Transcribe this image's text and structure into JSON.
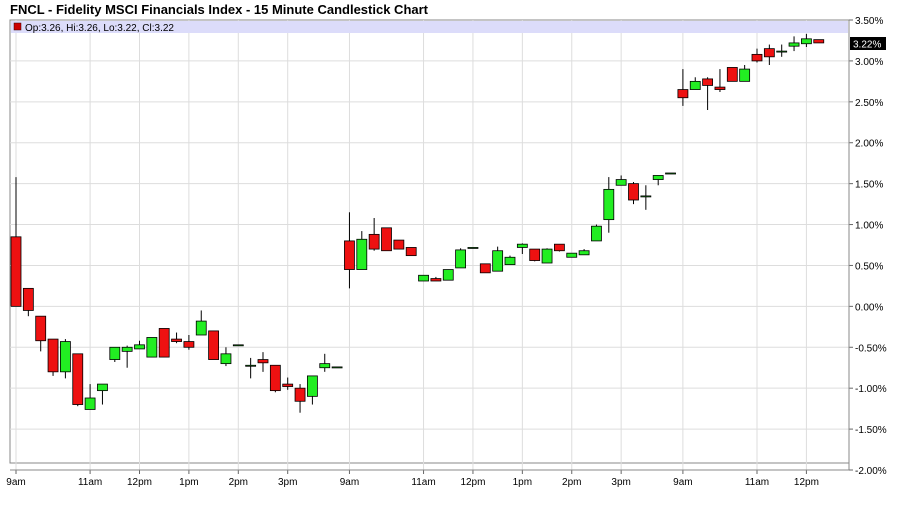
{
  "title": "FNCL - Fidelity MSCI Financials Index - 15 Minute Candlestick Chart",
  "ohlc_label": "Op:3.26, Hi:3.26, Lo:3.22, Cl:3.22",
  "last_value_label": "3.22%",
  "colors": {
    "up": "#22ee22",
    "down": "#ee1111",
    "grid": "#dddddd",
    "highlight": "#dcdcfa",
    "marker": "#cc0000"
  },
  "chart_data": {
    "type": "candlestick",
    "ylim": [
      -2.0,
      3.5
    ],
    "yticks": [
      {
        "v": 3.5,
        "label": "3.50%"
      },
      {
        "v": 3.0,
        "label": "3.00%"
      },
      {
        "v": 2.5,
        "label": "2.50%"
      },
      {
        "v": 2.0,
        "label": "2.00%"
      },
      {
        "v": 1.5,
        "label": "1.50%"
      },
      {
        "v": 1.0,
        "label": "1.00%"
      },
      {
        "v": 0.5,
        "label": "0.50%"
      },
      {
        "v": 0.0,
        "label": "0.00%"
      },
      {
        "v": -0.5,
        "label": "-0.50%"
      },
      {
        "v": -1.0,
        "label": "-1.00%"
      },
      {
        "v": -1.5,
        "label": "-1.50%"
      },
      {
        "v": -2.0,
        "label": "-2.00%"
      }
    ],
    "xticks": [
      {
        "i": 0,
        "label": "9am"
      },
      {
        "i": 6,
        "label": "11am"
      },
      {
        "i": 10,
        "label": "12pm"
      },
      {
        "i": 14,
        "label": "1pm"
      },
      {
        "i": 18,
        "label": "2pm"
      },
      {
        "i": 22,
        "label": "3pm"
      },
      {
        "i": 27,
        "label": "9am"
      },
      {
        "i": 33,
        "label": "11am"
      },
      {
        "i": 37,
        "label": "12pm"
      },
      {
        "i": 41,
        "label": "1pm"
      },
      {
        "i": 45,
        "label": "2pm"
      },
      {
        "i": 49,
        "label": "3pm"
      },
      {
        "i": 54,
        "label": "9am"
      },
      {
        "i": 60,
        "label": "11am"
      },
      {
        "i": 64,
        "label": "12pm"
      }
    ],
    "candles": [
      {
        "o": 0.85,
        "h": 1.58,
        "l": 0.0,
        "c": 0.0
      },
      {
        "o": 0.22,
        "h": 0.22,
        "l": -0.12,
        "c": -0.05
      },
      {
        "o": -0.12,
        "h": -0.12,
        "l": -0.55,
        "c": -0.42
      },
      {
        "o": -0.4,
        "h": -0.45,
        "l": -0.85,
        "c": -0.8
      },
      {
        "o": -0.8,
        "h": -0.4,
        "l": -0.88,
        "c": -0.43
      },
      {
        "o": -0.58,
        "h": -0.58,
        "l": -1.22,
        "c": -1.2
      },
      {
        "o": -1.26,
        "h": -0.95,
        "l": -1.26,
        "c": -1.12
      },
      {
        "o": -1.03,
        "h": -0.95,
        "l": -1.2,
        "c": -0.95
      },
      {
        "o": -0.65,
        "h": -0.5,
        "l": -0.68,
        "c": -0.5
      },
      {
        "o": -0.55,
        "h": -0.48,
        "l": -0.75,
        "c": -0.5
      },
      {
        "o": -0.52,
        "h": -0.42,
        "l": -0.52,
        "c": -0.47
      },
      {
        "o": -0.62,
        "h": -0.38,
        "l": -0.62,
        "c": -0.38
      },
      {
        "o": -0.27,
        "h": -0.27,
        "l": -0.62,
        "c": -0.62
      },
      {
        "o": -0.4,
        "h": -0.32,
        "l": -0.45,
        "c": -0.43
      },
      {
        "o": -0.43,
        "h": -0.35,
        "l": -0.53,
        "c": -0.5
      },
      {
        "o": -0.35,
        "h": -0.05,
        "l": -0.35,
        "c": -0.18
      },
      {
        "o": -0.3,
        "h": -0.3,
        "l": -0.65,
        "c": -0.65
      },
      {
        "o": -0.7,
        "h": -0.5,
        "l": -0.73,
        "c": -0.58
      },
      {
        "o": -0.47,
        "h": -0.47,
        "l": -0.47,
        "c": -0.47
      },
      {
        "o": -0.72,
        "h": -0.63,
        "l": -0.88,
        "c": -0.72
      },
      {
        "o": -0.65,
        "h": -0.56,
        "l": -0.8,
        "c": -0.69
      },
      {
        "o": -0.72,
        "h": -0.72,
        "l": -1.05,
        "c": -1.03
      },
      {
        "o": -0.95,
        "h": -0.87,
        "l": -1.02,
        "c": -0.98
      },
      {
        "o": -1.0,
        "h": -0.95,
        "l": -1.3,
        "c": -1.16
      },
      {
        "o": -1.1,
        "h": -0.86,
        "l": -1.2,
        "c": -0.85
      },
      {
        "o": -0.75,
        "h": -0.58,
        "l": -0.8,
        "c": -0.7
      },
      {
        "o": -0.74,
        "h": -0.74,
        "l": -0.74,
        "c": -0.74
      },
      {
        "o": 0.8,
        "h": 1.15,
        "l": 0.22,
        "c": 0.45
      },
      {
        "o": 0.45,
        "h": 0.92,
        "l": 0.45,
        "c": 0.82
      },
      {
        "o": 0.88,
        "h": 1.08,
        "l": 0.68,
        "c": 0.7
      },
      {
        "o": 0.96,
        "h": 0.96,
        "l": 0.68,
        "c": 0.68
      },
      {
        "o": 0.81,
        "h": 0.81,
        "l": 0.7,
        "c": 0.7
      },
      {
        "o": 0.72,
        "h": 0.72,
        "l": 0.62,
        "c": 0.62
      },
      {
        "o": 0.31,
        "h": 0.38,
        "l": 0.31,
        "c": 0.38
      },
      {
        "o": 0.34,
        "h": 0.36,
        "l": 0.31,
        "c": 0.31
      },
      {
        "o": 0.32,
        "h": 0.45,
        "l": 0.32,
        "c": 0.45
      },
      {
        "o": 0.47,
        "h": 0.71,
        "l": 0.47,
        "c": 0.69
      },
      {
        "o": 0.72,
        "h": 0.72,
        "l": 0.72,
        "c": 0.72
      },
      {
        "o": 0.52,
        "h": 0.52,
        "l": 0.41,
        "c": 0.41
      },
      {
        "o": 0.43,
        "h": 0.73,
        "l": 0.43,
        "c": 0.68
      },
      {
        "o": 0.51,
        "h": 0.62,
        "l": 0.51,
        "c": 0.6
      },
      {
        "o": 0.72,
        "h": 0.77,
        "l": 0.64,
        "c": 0.76
      },
      {
        "o": 0.7,
        "h": 0.7,
        "l": 0.55,
        "c": 0.56
      },
      {
        "o": 0.53,
        "h": 0.71,
        "l": 0.53,
        "c": 0.7
      },
      {
        "o": 0.76,
        "h": 0.76,
        "l": 0.67,
        "c": 0.68
      },
      {
        "o": 0.6,
        "h": 0.65,
        "l": 0.6,
        "c": 0.65
      },
      {
        "o": 0.63,
        "h": 0.7,
        "l": 0.63,
        "c": 0.68
      },
      {
        "o": 0.8,
        "h": 1.0,
        "l": 0.8,
        "c": 0.98
      },
      {
        "o": 1.06,
        "h": 1.58,
        "l": 0.9,
        "c": 1.43
      },
      {
        "o": 1.48,
        "h": 1.6,
        "l": 1.48,
        "c": 1.55
      },
      {
        "o": 1.5,
        "h": 1.52,
        "l": 1.25,
        "c": 1.3
      },
      {
        "o": 1.35,
        "h": 1.48,
        "l": 1.18,
        "c": 1.35
      },
      {
        "o": 1.55,
        "h": 1.6,
        "l": 1.48,
        "c": 1.6
      },
      {
        "o": 1.63,
        "h": 1.63,
        "l": 1.63,
        "c": 1.63
      },
      {
        "o": 2.65,
        "h": 2.9,
        "l": 2.45,
        "c": 2.55
      },
      {
        "o": 2.65,
        "h": 2.8,
        "l": 2.65,
        "c": 2.75
      },
      {
        "o": 2.78,
        "h": 2.8,
        "l": 2.4,
        "c": 2.7
      },
      {
        "o": 2.68,
        "h": 2.9,
        "l": 2.62,
        "c": 2.65
      },
      {
        "o": 2.92,
        "h": 2.92,
        "l": 2.75,
        "c": 2.75
      },
      {
        "o": 2.75,
        "h": 2.95,
        "l": 2.75,
        "c": 2.9
      },
      {
        "o": 3.08,
        "h": 3.15,
        "l": 2.98,
        "c": 3.0
      },
      {
        "o": 3.15,
        "h": 3.2,
        "l": 2.95,
        "c": 3.05
      },
      {
        "o": 3.12,
        "h": 3.2,
        "l": 3.05,
        "c": 3.12
      },
      {
        "o": 3.18,
        "h": 3.3,
        "l": 3.12,
        "c": 3.22
      },
      {
        "o": 3.21,
        "h": 3.33,
        "l": 3.17,
        "c": 3.27
      },
      {
        "o": 3.26,
        "h": 3.26,
        "l": 3.22,
        "c": 3.22
      }
    ]
  }
}
